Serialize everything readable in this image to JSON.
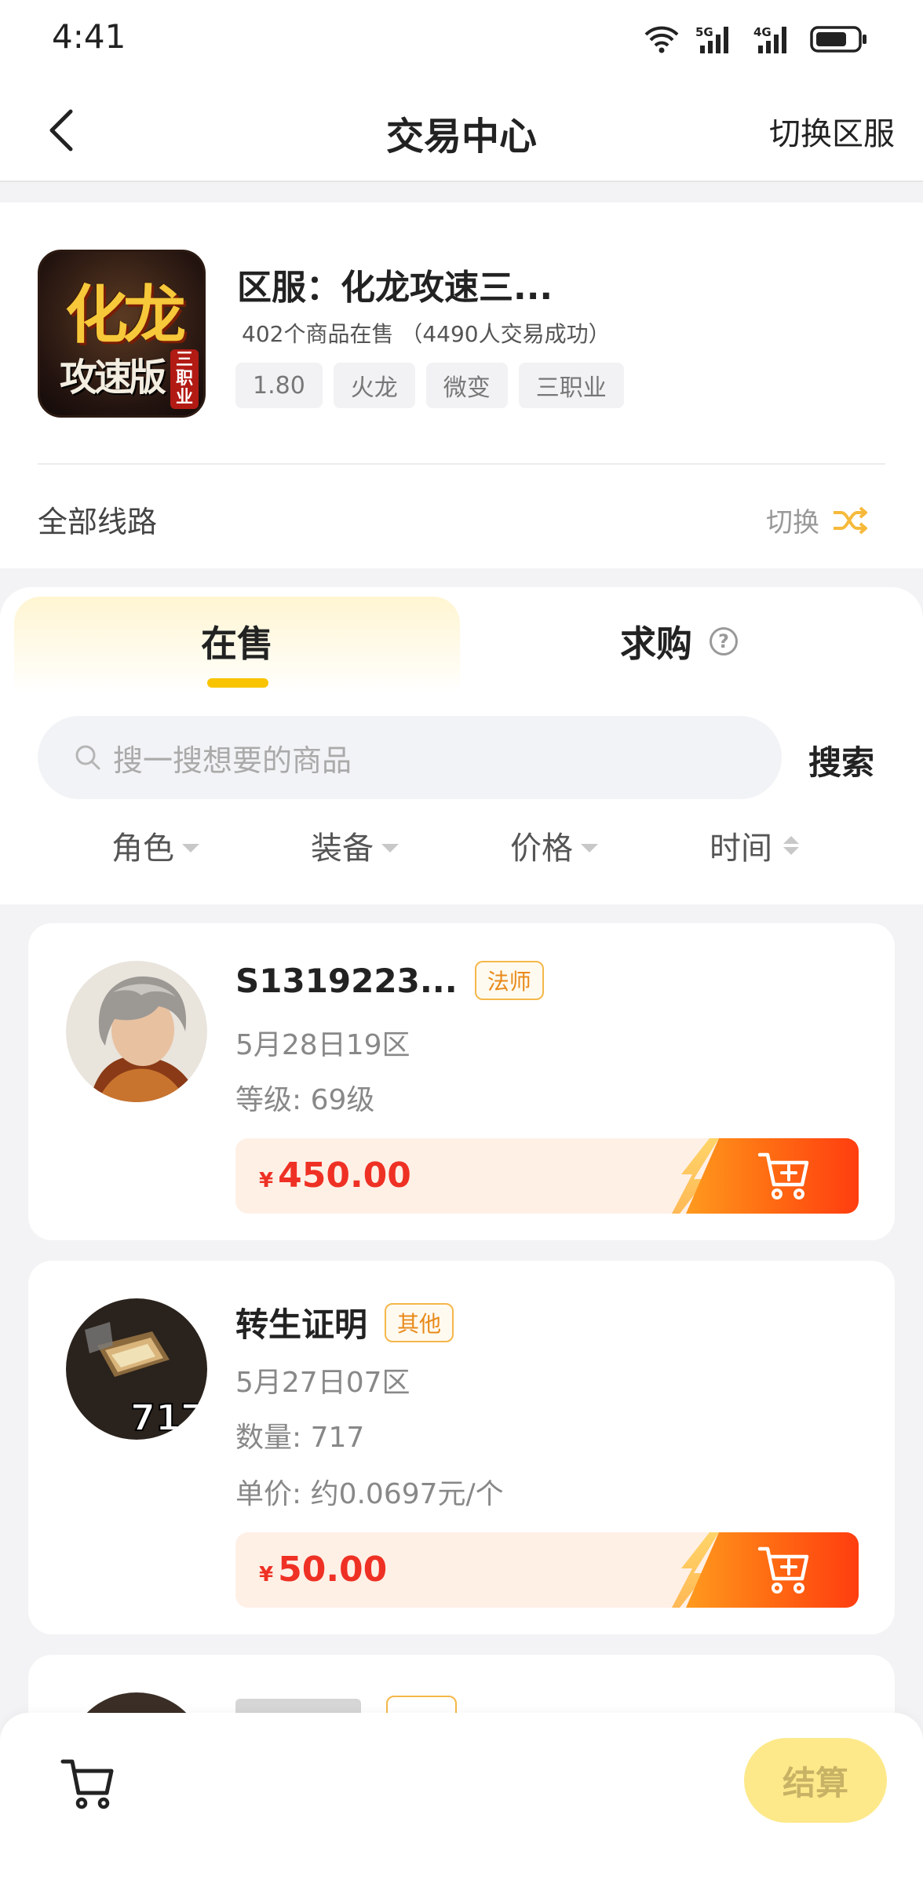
{
  "status_bar": {
    "time": "4:41",
    "signal_1_label": "5G",
    "signal_2_label": "4G"
  },
  "nav": {
    "title": "交易中心",
    "right_label": "切换区服"
  },
  "server": {
    "name": "区服：化龙攻速三...",
    "stats": "402个商品在售 （4490人交易成功）",
    "logo_text_1": "化龙",
    "logo_text_2": "攻速版",
    "logo_text_3": "三职业",
    "tags": [
      "1.80",
      "火龙",
      "微变",
      "三职业"
    ],
    "route_label": "全部线路",
    "route_switch_label": "切换"
  },
  "market": {
    "tabs": [
      {
        "label": "在售",
        "active": true
      },
      {
        "label": "求购",
        "active": false
      }
    ],
    "search_placeholder": "搜一搜想要的商品",
    "search_button": "搜索",
    "filters": [
      "角色",
      "装备",
      "价格",
      "时间"
    ]
  },
  "listings": [
    {
      "title": "S1319223...",
      "badge": "法师",
      "date": "5月28日19区",
      "detail_1": "等级: 69级",
      "currency": "¥",
      "price": "450.00"
    },
    {
      "title": "转生证明",
      "badge": "其他",
      "date": "5月27日07区",
      "detail_1": "数量: 717",
      "detail_2": "单价: 约0.0697元/个",
      "avatar_text": "717",
      "currency": "¥",
      "price": "50.00"
    }
  ],
  "bottom_bar": {
    "checkout_label": "结算"
  },
  "colors": {
    "accent_yellow": "#f8c400",
    "price_red": "#ee3124",
    "cart_orange": "#ff6a12",
    "badge_orange": "#e88a1a"
  }
}
